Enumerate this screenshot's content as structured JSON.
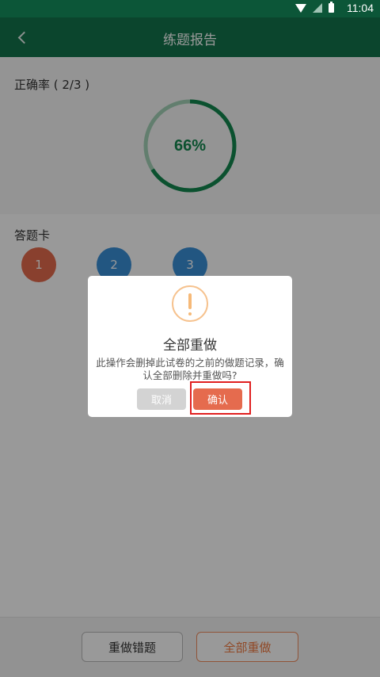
{
  "status_bar": {
    "time": "11:04",
    "icons": [
      "wifi-icon",
      "signal-icon",
      "battery-icon"
    ]
  },
  "app_bar": {
    "title": "练题报告",
    "back_icon": "chevron-left-icon"
  },
  "score": {
    "accuracy_label": "正确率 ( 2/3 )",
    "percent_text": "66%",
    "percent_fraction": 0.66
  },
  "answer_card": {
    "title": "答题卡",
    "items": [
      {
        "label": "1",
        "status": "wrong",
        "color": "#e56b4e"
      },
      {
        "label": "2",
        "status": "correct",
        "color": "#3a8fd8"
      },
      {
        "label": "3",
        "status": "correct",
        "color": "#3a8fd8"
      }
    ]
  },
  "bottom_bar": {
    "redo_wrong_label": "重做错题",
    "redo_all_label": "全部重做"
  },
  "dialog": {
    "icon": "alert-icon",
    "title": "全部重做",
    "message": "此操作会删掉此试卷的之前的做题记录，确认全部删除并重做吗?",
    "cancel_label": "取消",
    "confirm_label": "确认"
  },
  "colors": {
    "app_bar": "#13744c",
    "status_bar": "#0c5638",
    "progress": "#13874f",
    "progress_track": "#a4d2b8",
    "accent_orange": "#f07a42",
    "confirm": "#e56b4e",
    "highlight": "#e02020"
  }
}
